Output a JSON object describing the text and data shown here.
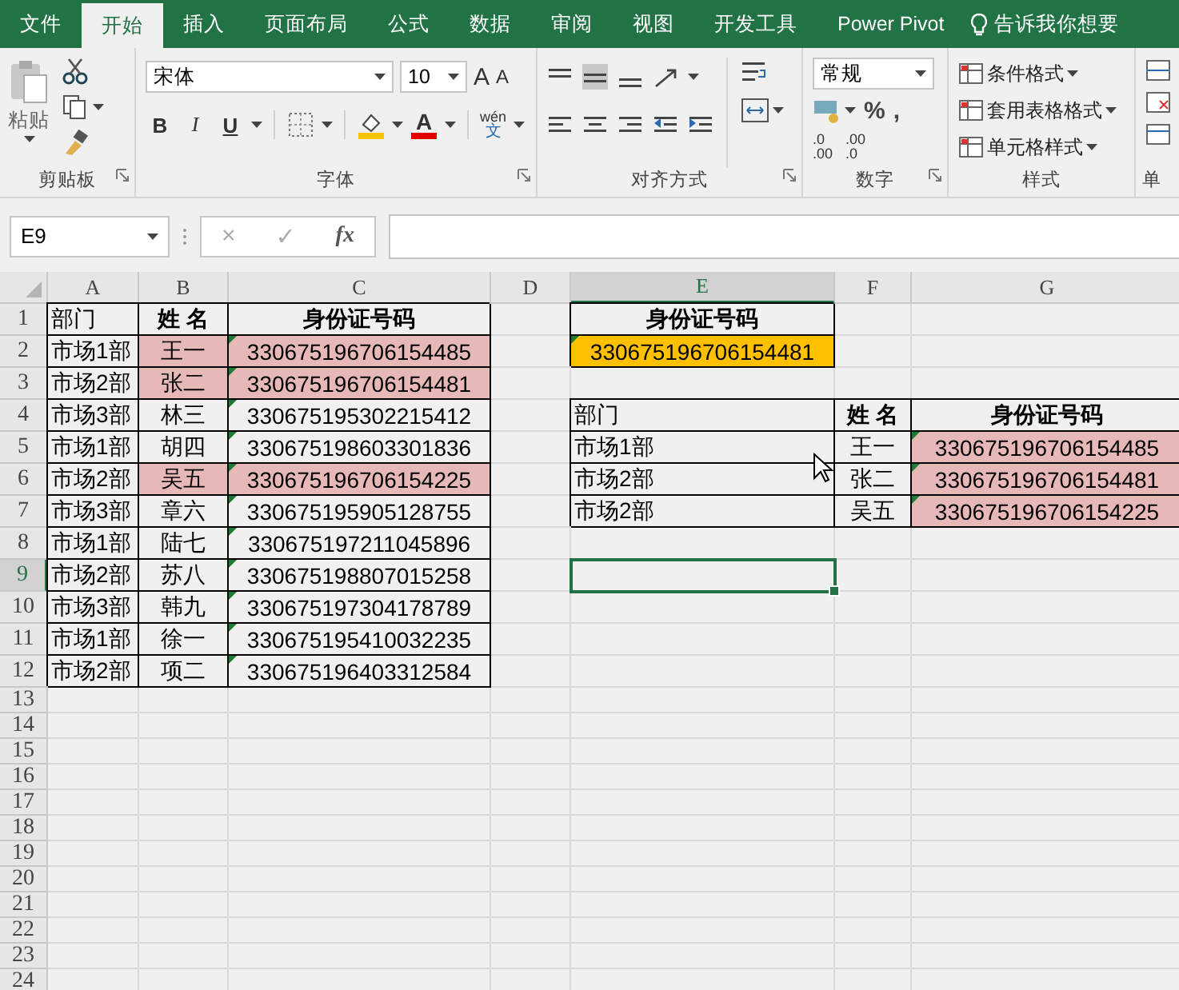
{
  "ribbon_tabs": [
    {
      "label": "文件",
      "selected": false
    },
    {
      "label": "开始",
      "selected": true
    },
    {
      "label": "插入",
      "selected": false
    },
    {
      "label": "页面布局",
      "selected": false
    },
    {
      "label": "公式",
      "selected": false
    },
    {
      "label": "数据",
      "selected": false
    },
    {
      "label": "审阅",
      "selected": false
    },
    {
      "label": "视图",
      "selected": false
    },
    {
      "label": "开发工具",
      "selected": false
    },
    {
      "label": "Power Pivot",
      "selected": false
    }
  ],
  "tell_me": {
    "placeholder": "告诉我你想要"
  },
  "ribbon": {
    "clipboard": {
      "paste": "粘贴",
      "label": "剪贴板"
    },
    "font": {
      "name": "宋体",
      "size": "10",
      "grow": "A",
      "shrink": "A",
      "bold": "B",
      "italic": "I",
      "underline": "U",
      "font_color": "A",
      "phonetic_top": "wén",
      "phonetic_bottom": "文",
      "label": "字体"
    },
    "alignment": {
      "label": "对齐方式"
    },
    "number": {
      "format": "常规",
      "percent": "%",
      "comma": ",",
      "increase_decimal": [
        ".0",
        ".00"
      ],
      "decrease_decimal": [
        ".00",
        ".0"
      ],
      "label": "数字"
    },
    "styles": {
      "items": [
        "条件格式",
        "套用表格格式",
        "单元格样式"
      ],
      "label": "样式"
    },
    "cells": {
      "label": "单"
    }
  },
  "formula_bar": {
    "name_box": "E9",
    "cancel": "×",
    "enter": "✓",
    "function": "fx"
  },
  "sheet": {
    "columns": [
      {
        "label": "A",
        "selected": false
      },
      {
        "label": "B",
        "selected": false
      },
      {
        "label": "C",
        "selected": false
      },
      {
        "label": "D",
        "selected": false
      },
      {
        "label": "E",
        "selected": true
      },
      {
        "label": "F",
        "selected": false
      },
      {
        "label": "G",
        "selected": false
      }
    ],
    "rows": [
      {
        "number": "1",
        "selected": false,
        "cells": [
          {
            "text": "部门",
            "kind": "text"
          },
          {
            "text": "姓  名",
            "kind": "header"
          },
          {
            "text": "身份证号码",
            "kind": "header"
          },
          {
            "text": ""
          },
          {
            "text": "身份证号码",
            "kind": "header"
          },
          {
            "text": ""
          },
          {
            "text": ""
          }
        ]
      },
      {
        "number": "2",
        "selected": false,
        "cells": [
          {
            "text": "市场1部",
            "kind": "text"
          },
          {
            "text": "王一",
            "kind": "center",
            "color": "#e6b8b7"
          },
          {
            "text": "330675196706154485",
            "kind": "center",
            "color": "#e6b8b7",
            "error_flag": true
          },
          {
            "text": ""
          },
          {
            "text": "330675196706154481",
            "kind": "center",
            "color": "#ffc000",
            "error_flag": true
          },
          {
            "text": ""
          },
          {
            "text": ""
          }
        ]
      },
      {
        "number": "3",
        "selected": false,
        "cells": [
          {
            "text": "市场2部",
            "kind": "text"
          },
          {
            "text": "张二",
            "kind": "center",
            "color": "#e6b8b7"
          },
          {
            "text": "330675196706154481",
            "kind": "center",
            "color": "#e6b8b7",
            "error_flag": true
          },
          {
            "text": ""
          },
          {
            "text": ""
          },
          {
            "text": ""
          },
          {
            "text": ""
          }
        ]
      },
      {
        "number": "4",
        "selected": false,
        "cells": [
          {
            "text": "市场3部",
            "kind": "text"
          },
          {
            "text": "林三",
            "kind": "center"
          },
          {
            "text": "330675195302215412",
            "kind": "center",
            "error_flag": true
          },
          {
            "text": ""
          },
          {
            "text": "部门",
            "kind": "text"
          },
          {
            "text": "姓  名",
            "kind": "header"
          },
          {
            "text": "身份证号码",
            "kind": "header"
          }
        ]
      },
      {
        "number": "5",
        "selected": false,
        "cells": [
          {
            "text": "市场1部",
            "kind": "text"
          },
          {
            "text": "胡四",
            "kind": "center"
          },
          {
            "text": "330675198603301836",
            "kind": "center",
            "error_flag": true
          },
          {
            "text": ""
          },
          {
            "text": "市场1部",
            "kind": "text"
          },
          {
            "text": "王一",
            "kind": "center"
          },
          {
            "text": "330675196706154485",
            "kind": "center",
            "color": "#e6b8b7",
            "error_flag": true
          }
        ]
      },
      {
        "number": "6",
        "selected": false,
        "cells": [
          {
            "text": "市场2部",
            "kind": "text"
          },
          {
            "text": "吴五",
            "kind": "center",
            "color": "#e6b8b7"
          },
          {
            "text": "330675196706154225",
            "kind": "center",
            "color": "#e6b8b7",
            "error_flag": true
          },
          {
            "text": ""
          },
          {
            "text": "市场2部",
            "kind": "text"
          },
          {
            "text": "张二",
            "kind": "center"
          },
          {
            "text": "330675196706154481",
            "kind": "center",
            "color": "#e6b8b7",
            "error_flag": true
          }
        ]
      },
      {
        "number": "7",
        "selected": false,
        "cells": [
          {
            "text": "市场3部",
            "kind": "text"
          },
          {
            "text": "章六",
            "kind": "center"
          },
          {
            "text": "330675195905128755",
            "kind": "center",
            "error_flag": true
          },
          {
            "text": ""
          },
          {
            "text": "市场2部",
            "kind": "text"
          },
          {
            "text": "吴五",
            "kind": "center"
          },
          {
            "text": "330675196706154225",
            "kind": "center",
            "color": "#e6b8b7",
            "error_flag": true
          }
        ]
      },
      {
        "number": "8",
        "selected": false,
        "cells": [
          {
            "text": "市场1部",
            "kind": "text"
          },
          {
            "text": "陆七",
            "kind": "center"
          },
          {
            "text": "330675197211045896",
            "kind": "center",
            "error_flag": true
          }
        ]
      },
      {
        "number": "9",
        "selected": true,
        "cells": [
          {
            "text": "市场2部",
            "kind": "text"
          },
          {
            "text": "苏八",
            "kind": "center"
          },
          {
            "text": "330675198807015258",
            "kind": "center",
            "error_flag": true
          }
        ]
      },
      {
        "number": "10",
        "selected": false,
        "cells": [
          {
            "text": "市场3部",
            "kind": "text"
          },
          {
            "text": "韩九",
            "kind": "center"
          },
          {
            "text": "330675197304178789",
            "kind": "center",
            "error_flag": true
          }
        ]
      },
      {
        "number": "11",
        "selected": false,
        "cells": [
          {
            "text": "市场1部",
            "kind": "text"
          },
          {
            "text": "徐一",
            "kind": "center"
          },
          {
            "text": "330675195410032235",
            "kind": "center",
            "error_flag": true
          }
        ]
      },
      {
        "number": "12",
        "selected": false,
        "cells": [
          {
            "text": "市场2部",
            "kind": "text"
          },
          {
            "text": "项二",
            "kind": "center"
          },
          {
            "text": "330675196403312584",
            "kind": "center",
            "error_flag": true
          }
        ]
      },
      {
        "number": "13",
        "selected": false,
        "cells": []
      },
      {
        "number": "14",
        "selected": false,
        "cells": []
      },
      {
        "number": "15",
        "selected": false,
        "cells": []
      },
      {
        "number": "16",
        "selected": false,
        "cells": []
      },
      {
        "number": "17",
        "selected": false,
        "cells": []
      },
      {
        "number": "18",
        "selected": false,
        "cells": []
      },
      {
        "number": "19",
        "selected": false,
        "cells": []
      },
      {
        "number": "20",
        "selected": false,
        "cells": []
      },
      {
        "number": "21",
        "selected": false,
        "cells": []
      },
      {
        "number": "22",
        "selected": false,
        "cells": []
      },
      {
        "number": "23",
        "selected": false,
        "cells": []
      },
      {
        "number": "24",
        "selected": false,
        "cells": []
      }
    ]
  }
}
